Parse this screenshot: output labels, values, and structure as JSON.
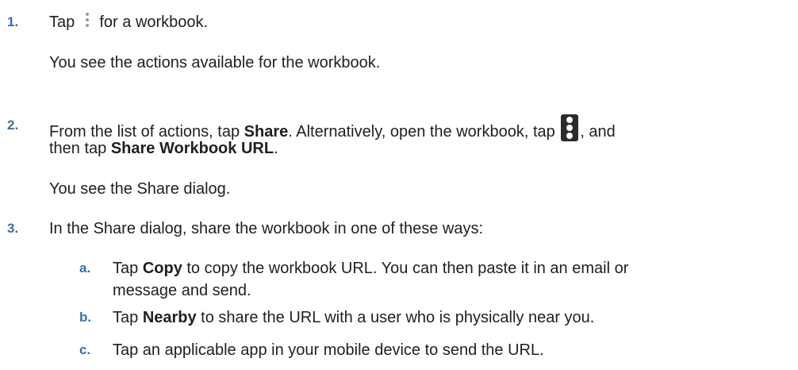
{
  "steps": [
    {
      "number": "1.",
      "line_pre": "Tap",
      "line_post": "for a workbook.",
      "icon": "kebab-menu-icon",
      "result": "You see the actions available for the workbook."
    },
    {
      "number": "2.",
      "line1_pre": "From the list of actions, tap ",
      "line1_bold": "Share",
      "line1_mid": ". Alternatively, open the workbook, tap",
      "line1_post": ", and",
      "line2_pre": "then tap ",
      "line2_bold": "Share Workbook URL",
      "line2_post": ".",
      "icon": "kebab-menu-icon",
      "result": "You see the Share dialog."
    },
    {
      "number": "3.",
      "text": "In the Share dialog, share the workbook in one of these ways:",
      "substeps": [
        {
          "letter": "a.",
          "pre": "Tap ",
          "bold": "Copy",
          "line1_post": " to copy the workbook URL. You can then paste it in an email or",
          "line2": "message and send."
        },
        {
          "letter": "b.",
          "pre": "Tap ",
          "bold": "Nearby",
          "post": " to share the URL with a user who is physically near you."
        },
        {
          "letter": "c.",
          "text": "Tap an applicable app in your mobile device to send the URL."
        }
      ]
    }
  ]
}
